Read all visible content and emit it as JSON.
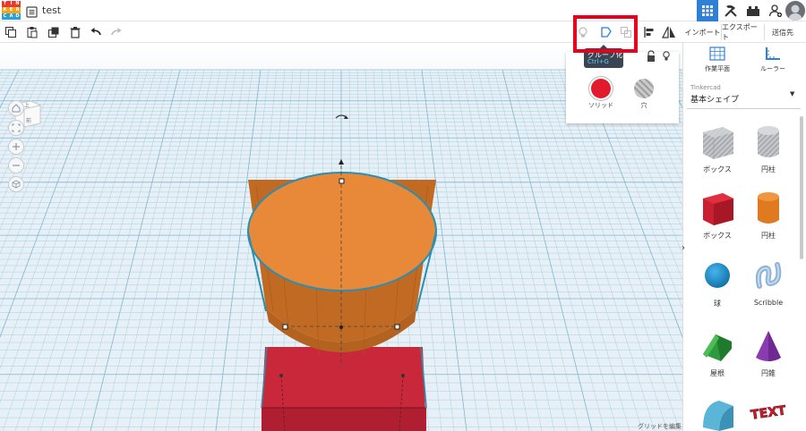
{
  "app": {
    "logo_letters": [
      "T",
      "I",
      "N",
      "K",
      "E",
      "R",
      "C",
      "A",
      "D"
    ],
    "document_title": "test"
  },
  "toolbar": {
    "import_label": "インポート",
    "export_label": "エクスポート",
    "send_label": "送信先"
  },
  "tooltip": {
    "title": "グループ化",
    "shortcut": "Ctrl+G"
  },
  "inspector": {
    "solid_label": "ソリッド",
    "hole_label": "穴",
    "solid_color": "#e21b2c"
  },
  "viewcube": {
    "top_label": "上",
    "front_label": "前"
  },
  "workplane": {
    "edit_grid_label": "グリッドを編集"
  },
  "panel": {
    "workplane_tool_label": "作業平面",
    "ruler_tool_label": "ルーラー",
    "library_brand": "Tinkercad",
    "library_name": "基本シェイプ",
    "shapes": [
      {
        "label": "ボックス",
        "icon": "box-hole-icon"
      },
      {
        "label": "円柱",
        "icon": "cylinder-hole-icon"
      },
      {
        "label": "ボックス",
        "icon": "box-icon"
      },
      {
        "label": "円柱",
        "icon": "cylinder-icon"
      },
      {
        "label": "球",
        "icon": "sphere-icon"
      },
      {
        "label": "Scribble",
        "icon": "scribble-icon"
      },
      {
        "label": "屋根",
        "icon": "roof-icon"
      },
      {
        "label": "円錐",
        "icon": "cone-icon"
      },
      {
        "label": "",
        "icon": "round-roof-icon"
      },
      {
        "label": "",
        "icon": "text-icon"
      }
    ],
    "text_shape_letters": "TEXT"
  },
  "colors": {
    "accent_blue": "#2f7fd4",
    "highlight_red": "#e8001c",
    "cylinder_orange": "#e8893a",
    "box_red": "#c9273a"
  }
}
